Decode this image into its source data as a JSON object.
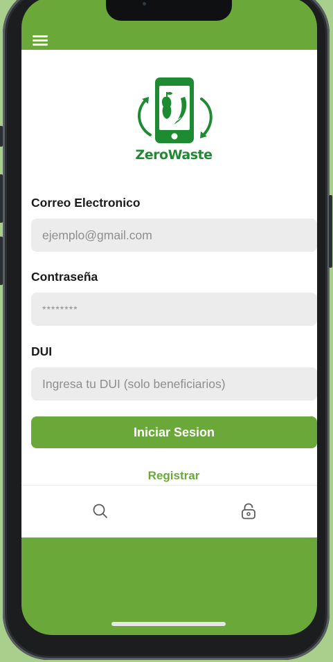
{
  "app": {
    "name": "ZeroWaste",
    "accent_color": "#6aa83a",
    "logo_color": "#1e8b32"
  },
  "header": {
    "menu_icon": "hamburger-menu-icon"
  },
  "form": {
    "email": {
      "label": "Correo Electronico",
      "placeholder": "ejemplo@gmail.com"
    },
    "password": {
      "label": "Contraseña",
      "placeholder": "********"
    },
    "dui": {
      "label": "DUI",
      "placeholder": "Ingresa tu DUI (solo beneficiarios)"
    },
    "login_button": "Iniciar Sesion",
    "register_link": "Registrar"
  },
  "bottom_nav": {
    "items": [
      {
        "icon": "search-icon"
      },
      {
        "icon": "lock-icon"
      }
    ]
  }
}
